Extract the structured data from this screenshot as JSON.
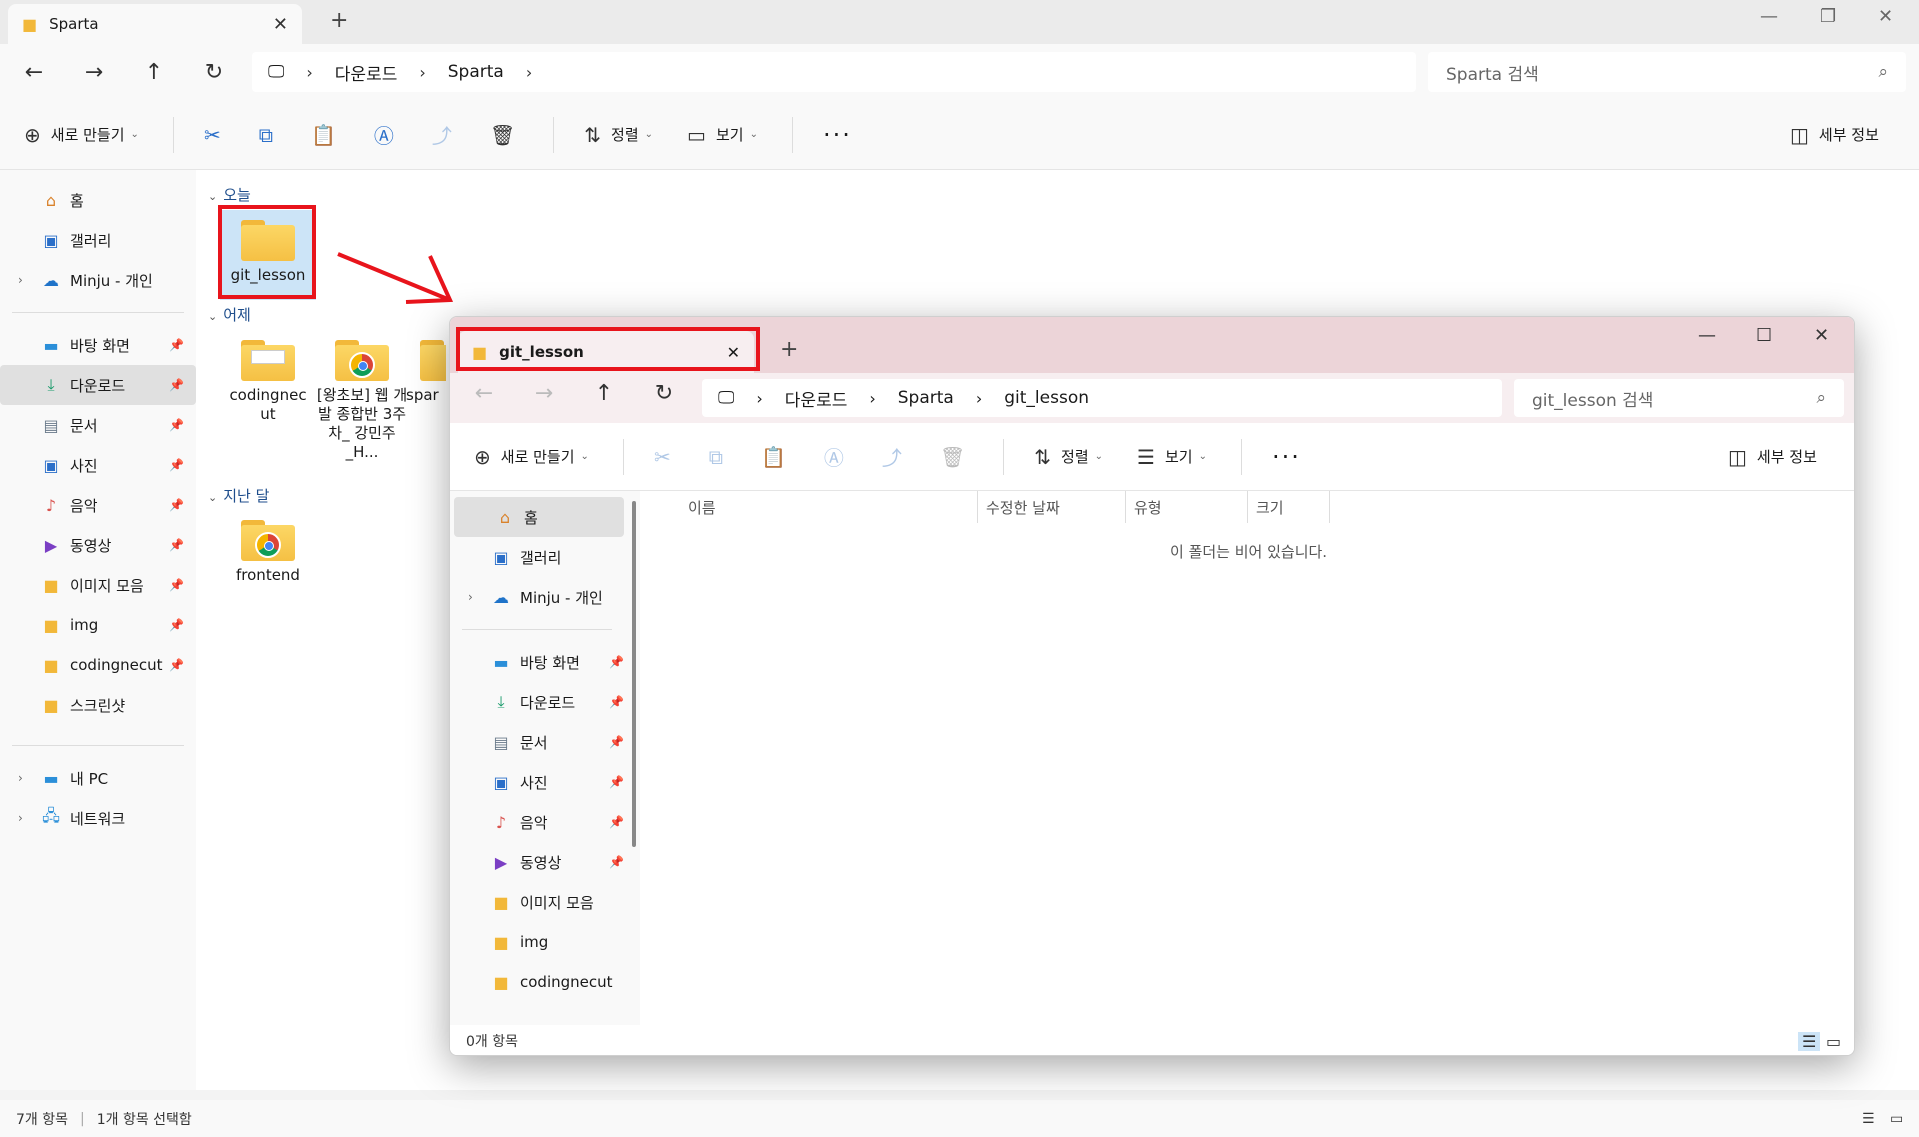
{
  "back_window": {
    "tab_title": "Sparta",
    "path": [
      "다운로드",
      "Sparta"
    ],
    "search_placeholder": "Sparta 검색",
    "toolbar": {
      "new": "새로 만들기",
      "sort": "정렬",
      "view": "보기",
      "details": "세부 정보"
    },
    "sidebar": {
      "top": [
        {
          "label": "홈",
          "icon": "home-icon"
        },
        {
          "label": "갤러리",
          "icon": "gallery-icon"
        },
        {
          "label": "Minju - 개인",
          "icon": "onedrive-icon"
        }
      ],
      "pinned": [
        {
          "label": "바탕 화면",
          "icon": "desktop-icon"
        },
        {
          "label": "다운로드",
          "icon": "download-icon"
        },
        {
          "label": "문서",
          "icon": "document-icon"
        },
        {
          "label": "사진",
          "icon": "pictures-icon"
        },
        {
          "label": "음악",
          "icon": "music-icon"
        },
        {
          "label": "동영상",
          "icon": "video-icon"
        },
        {
          "label": "이미지 모음",
          "icon": "folder-icon"
        },
        {
          "label": "img",
          "icon": "folder-icon"
        },
        {
          "label": "codingnecut",
          "icon": "folder-icon"
        },
        {
          "label": "스크린샷",
          "icon": "folder-icon"
        }
      ],
      "bottom": [
        {
          "label": "내 PC",
          "icon": "pc-icon"
        },
        {
          "label": "네트워크",
          "icon": "network-icon"
        }
      ]
    },
    "groups": {
      "today": "오늘",
      "yesterday": "어제",
      "last_month": "지난 달"
    },
    "files": {
      "git_lesson": "git_lesson",
      "codingnecut": "codingnec ut",
      "wangchobo": "[왕초보] 웹 개발 종합반 3주차_ 강민주_H...",
      "spar": "spar",
      "frontend": "frontend"
    },
    "status": {
      "count": "7개 항목",
      "selected": "1개 항목 선택함"
    }
  },
  "front_window": {
    "tab_title": "git_lesson",
    "path": [
      "다운로드",
      "Sparta",
      "git_lesson"
    ],
    "search_placeholder": "git_lesson 검색",
    "toolbar": {
      "new": "새로 만들기",
      "sort": "정렬",
      "view": "보기",
      "details": "세부 정보"
    },
    "sidebar": {
      "top": [
        {
          "label": "홈"
        },
        {
          "label": "갤러리"
        },
        {
          "label": "Minju - 개인"
        }
      ],
      "pinned": [
        {
          "label": "바탕 화면"
        },
        {
          "label": "다운로드"
        },
        {
          "label": "문서"
        },
        {
          "label": "사진"
        },
        {
          "label": "음악"
        },
        {
          "label": "동영상"
        },
        {
          "label": "이미지 모음"
        },
        {
          "label": "img"
        },
        {
          "label": "codingnecut"
        }
      ]
    },
    "columns": {
      "name": "이름",
      "modified": "수정한 날짜",
      "type": "유형",
      "size": "크기"
    },
    "empty_message": "이 폴더는 비어 있습니다.",
    "status": "0개 항목"
  },
  "colors": {
    "highlight_red": "#e8141c",
    "front_tab_bg": "#ecd4d8",
    "folder_yellow": "#fcd765"
  }
}
